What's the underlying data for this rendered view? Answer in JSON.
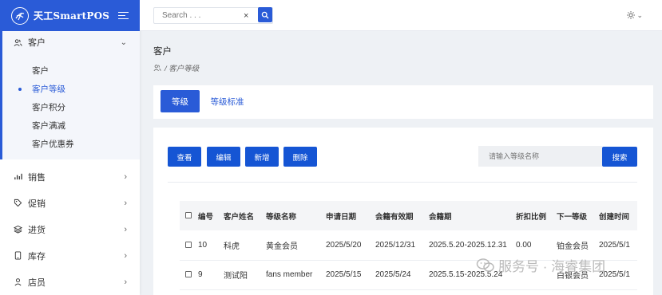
{
  "app": {
    "title": "天工SmartPOS"
  },
  "sidebar": {
    "open_group": {
      "label": "客户",
      "icon": "users-icon",
      "items": [
        {
          "label": "客户",
          "active": false
        },
        {
          "label": "客户等级",
          "active": true
        },
        {
          "label": "客户积分",
          "active": false
        },
        {
          "label": "客户满减",
          "active": false
        },
        {
          "label": "客户优惠券",
          "active": false
        }
      ]
    },
    "items": [
      {
        "label": "销售",
        "icon": "bar-chart-icon"
      },
      {
        "label": "促销",
        "icon": "tag-icon"
      },
      {
        "label": "进货",
        "icon": "layers-icon"
      },
      {
        "label": "库存",
        "icon": "tablet-icon"
      },
      {
        "label": "店员",
        "icon": "user-icon"
      }
    ]
  },
  "topbar": {
    "search_placeholder": "Search . . .",
    "clear_symbol": "×"
  },
  "page": {
    "title": "客户",
    "breadcrumb": "/ 客户等级"
  },
  "tabs": [
    {
      "label": "等级",
      "active": true
    },
    {
      "label": "等级标准",
      "active": false
    }
  ],
  "toolbar": {
    "view_label": "查看",
    "edit_label": "编辑",
    "add_label": "新增",
    "delete_label": "删除",
    "filter_placeholder": "请输入等级名称",
    "search_label": "搜索"
  },
  "table": {
    "columns": [
      "编号",
      "客户姓名",
      "等级名称",
      "申请日期",
      "会籍有效期",
      "会籍期",
      "折扣比例",
      "下一等级",
      "创建时间"
    ],
    "rows": [
      [
        "10",
        "科虎",
        "黄金会员",
        "2025/5/20",
        "2025/12/31",
        "2025.5.20-2025.12.31",
        "0.00",
        "铂金会员",
        "2025/5/1"
      ],
      [
        "9",
        "测试阳",
        "fans member",
        "2025/5/15",
        "2025/5/24",
        "2025.5.15-2025.5.24",
        "",
        "白银会员",
        "2025/5/1"
      ]
    ]
  },
  "watermark": {
    "text": "服务号 · 海睿集团"
  },
  "colors": {
    "primary": "#2a5bd7",
    "button": "#1555d4"
  }
}
